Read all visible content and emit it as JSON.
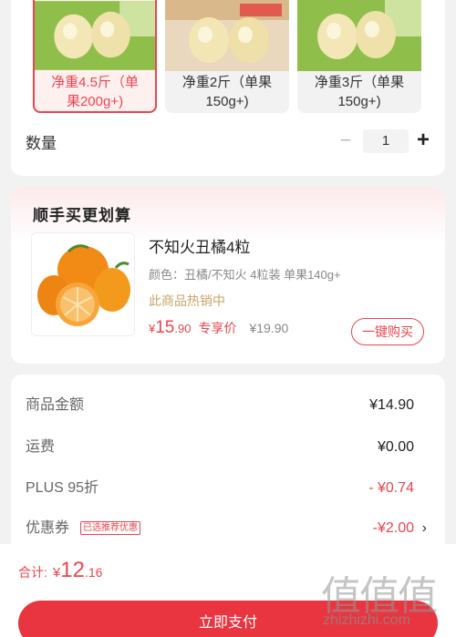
{
  "spec_options": [
    {
      "label": "净重4.5斤（单果200g+)",
      "selected": true
    },
    {
      "label": "净重2斤（单果150g+)",
      "selected": false
    },
    {
      "label": "净重3斤（单果150g+)",
      "selected": false
    }
  ],
  "spec_option_lines": [
    [
      "净重4.5斤（单",
      "果200g+)"
    ],
    [
      "净重2斤（单果",
      "150g+)"
    ],
    [
      "净重3斤（单果",
      "150g+)"
    ]
  ],
  "quantity": {
    "label": "数量",
    "value": "1",
    "minus_icon": "minus-icon",
    "plus_icon": "plus-icon"
  },
  "upsell": {
    "title": "顺手买更划算",
    "product": {
      "name": "不知火丑橘4粒",
      "spec": "颜色：丑橘/不知火 4粒装 单果140g+",
      "hot": "此商品热销中",
      "price_symbol": "¥",
      "price_int": "15",
      "price_dec": ".90",
      "price_tag": "专享价",
      "original_price": "¥19.90",
      "buy_label": "一键购买"
    }
  },
  "summary": {
    "rows": [
      {
        "label": "商品金额",
        "value": "¥14.90"
      },
      {
        "label": "运费",
        "value": "¥0.00"
      },
      {
        "label": "PLUS 95折",
        "value": "- ¥0.74"
      },
      {
        "label": "优惠券",
        "value": "-¥2.00",
        "badge": "已选推荐优惠"
      }
    ],
    "chevron": "›"
  },
  "footer": {
    "total_label": "合计:",
    "total_symbol": "¥",
    "total_int": "12",
    "total_dec": ".16",
    "pay_label": "立即支付"
  },
  "watermark": {
    "chars": "值值值",
    "url": "zhizhizhi.com"
  },
  "colors": {
    "accent": "#e8474f",
    "pay_button": "#e8353f",
    "hot_text": "#c9a46a"
  }
}
